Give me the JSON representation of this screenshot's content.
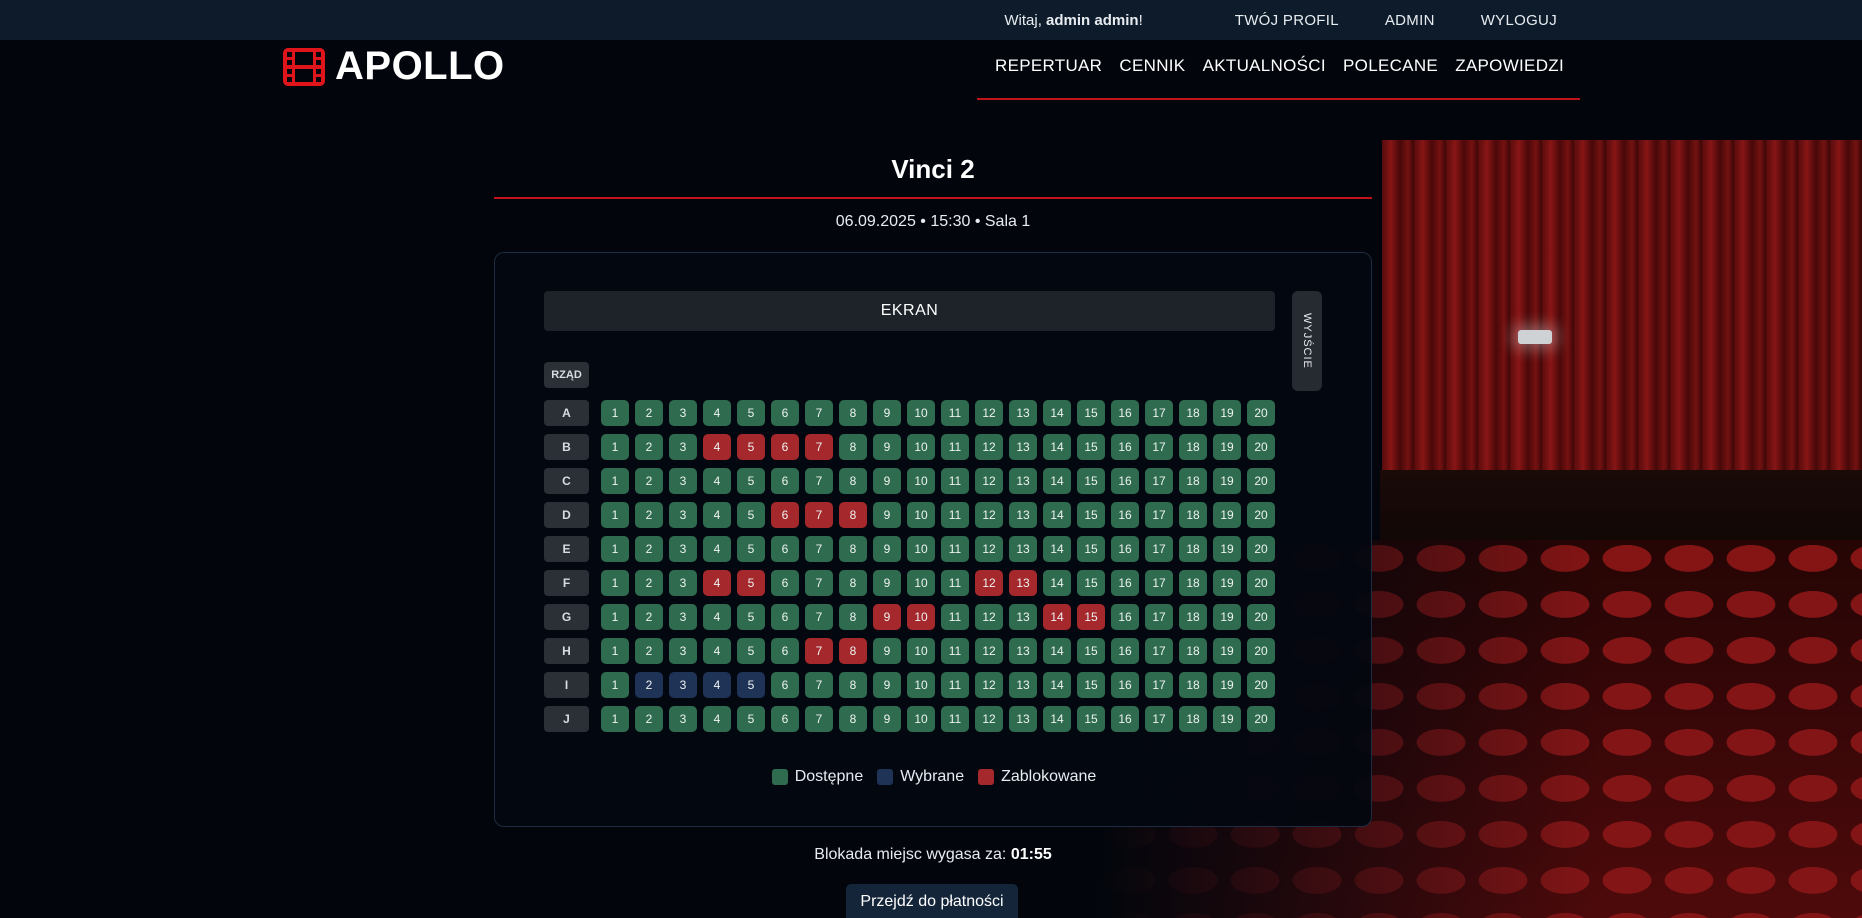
{
  "topbar": {
    "greet_prefix": "Witaj,",
    "user_name": "admin admin",
    "greet_suffix": "!",
    "links": [
      "TWÓJ PROFIL",
      "ADMIN",
      "WYLOGUJ"
    ]
  },
  "brand": {
    "name": "APOLLO",
    "icon": "film-icon",
    "icon_color": "#e0141b"
  },
  "nav": [
    "REPERTUAR",
    "CENNIK",
    "AKTUALNOŚCI",
    "POLECANE",
    "ZAPOWIEDZI"
  ],
  "movie": {
    "title": "Vinci 2",
    "showtime": "06.09.2025 • 15:30 • Sala 1"
  },
  "hall": {
    "screen_label": "EKRAN",
    "exit_label": "WYJŚCIE",
    "row_header": "RZĄD",
    "seats_per_row": 20,
    "rows": [
      {
        "label": "A",
        "blocked": [],
        "selected": []
      },
      {
        "label": "B",
        "blocked": [
          4,
          5,
          6,
          7
        ],
        "selected": []
      },
      {
        "label": "C",
        "blocked": [],
        "selected": []
      },
      {
        "label": "D",
        "blocked": [
          6,
          7,
          8
        ],
        "selected": []
      },
      {
        "label": "E",
        "blocked": [],
        "selected": []
      },
      {
        "label": "F",
        "blocked": [
          4,
          5,
          12,
          13
        ],
        "selected": []
      },
      {
        "label": "G",
        "blocked": [
          9,
          10,
          14,
          15
        ],
        "selected": []
      },
      {
        "label": "H",
        "blocked": [
          7,
          8
        ],
        "selected": []
      },
      {
        "label": "I",
        "blocked": [],
        "selected": [
          2,
          3,
          4,
          5
        ]
      },
      {
        "label": "J",
        "blocked": [],
        "selected": []
      }
    ]
  },
  "legend": [
    {
      "label": "Dostępne",
      "color": "#2f6b4f"
    },
    {
      "label": "Wybrane",
      "color": "#1f3357"
    },
    {
      "label": "Zablokowane",
      "color": "#a4282c"
    }
  ],
  "lock": {
    "label": "Blokada miejsc wygasa za:",
    "time": "01:55"
  },
  "pay_button": "Przejdź do płatności"
}
